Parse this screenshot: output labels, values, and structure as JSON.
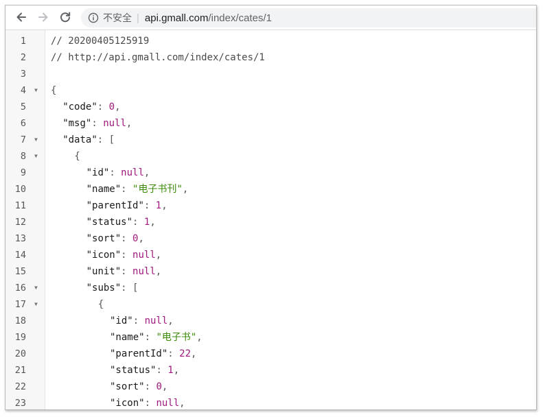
{
  "browser": {
    "security_label": "不安全",
    "url_host": "api.gmall.com",
    "url_path": "/index/cates/1"
  },
  "code_lines": [
    {
      "n": "1",
      "fold": false,
      "indent": 0,
      "parts": [
        {
          "t": "// 20200405125919",
          "c": "c"
        }
      ]
    },
    {
      "n": "2",
      "fold": false,
      "indent": 0,
      "parts": [
        {
          "t": "// http://api.gmall.com/index/cates/1",
          "c": "c"
        }
      ]
    },
    {
      "n": "3",
      "fold": false,
      "indent": 0,
      "parts": []
    },
    {
      "n": "4",
      "fold": true,
      "indent": 0,
      "parts": [
        {
          "t": "{",
          "c": "p"
        }
      ]
    },
    {
      "n": "5",
      "fold": false,
      "indent": 2,
      "parts": [
        {
          "t": "\"code\"",
          "c": "k"
        },
        {
          "t": ": ",
          "c": "p"
        },
        {
          "t": "0",
          "c": "n"
        },
        {
          "t": ",",
          "c": "p"
        }
      ]
    },
    {
      "n": "6",
      "fold": false,
      "indent": 2,
      "parts": [
        {
          "t": "\"msg\"",
          "c": "k"
        },
        {
          "t": ": ",
          "c": "p"
        },
        {
          "t": "null",
          "c": "n"
        },
        {
          "t": ",",
          "c": "p"
        }
      ]
    },
    {
      "n": "7",
      "fold": true,
      "indent": 2,
      "parts": [
        {
          "t": "\"data\"",
          "c": "k"
        },
        {
          "t": ": [",
          "c": "p"
        }
      ]
    },
    {
      "n": "8",
      "fold": true,
      "indent": 4,
      "parts": [
        {
          "t": "{",
          "c": "p"
        }
      ]
    },
    {
      "n": "9",
      "fold": false,
      "indent": 6,
      "parts": [
        {
          "t": "\"id\"",
          "c": "k"
        },
        {
          "t": ": ",
          "c": "p"
        },
        {
          "t": "null",
          "c": "n"
        },
        {
          "t": ",",
          "c": "p"
        }
      ]
    },
    {
      "n": "10",
      "fold": false,
      "indent": 6,
      "parts": [
        {
          "t": "\"name\"",
          "c": "k"
        },
        {
          "t": ": ",
          "c": "p"
        },
        {
          "t": "\"电子书刊\"",
          "c": "s"
        },
        {
          "t": ",",
          "c": "p"
        }
      ]
    },
    {
      "n": "11",
      "fold": false,
      "indent": 6,
      "parts": [
        {
          "t": "\"parentId\"",
          "c": "k"
        },
        {
          "t": ": ",
          "c": "p"
        },
        {
          "t": "1",
          "c": "n"
        },
        {
          "t": ",",
          "c": "p"
        }
      ]
    },
    {
      "n": "12",
      "fold": false,
      "indent": 6,
      "parts": [
        {
          "t": "\"status\"",
          "c": "k"
        },
        {
          "t": ": ",
          "c": "p"
        },
        {
          "t": "1",
          "c": "n"
        },
        {
          "t": ",",
          "c": "p"
        }
      ]
    },
    {
      "n": "13",
      "fold": false,
      "indent": 6,
      "parts": [
        {
          "t": "\"sort\"",
          "c": "k"
        },
        {
          "t": ": ",
          "c": "p"
        },
        {
          "t": "0",
          "c": "n"
        },
        {
          "t": ",",
          "c": "p"
        }
      ]
    },
    {
      "n": "14",
      "fold": false,
      "indent": 6,
      "parts": [
        {
          "t": "\"icon\"",
          "c": "k"
        },
        {
          "t": ": ",
          "c": "p"
        },
        {
          "t": "null",
          "c": "n"
        },
        {
          "t": ",",
          "c": "p"
        }
      ]
    },
    {
      "n": "15",
      "fold": false,
      "indent": 6,
      "parts": [
        {
          "t": "\"unit\"",
          "c": "k"
        },
        {
          "t": ": ",
          "c": "p"
        },
        {
          "t": "null",
          "c": "n"
        },
        {
          "t": ",",
          "c": "p"
        }
      ]
    },
    {
      "n": "16",
      "fold": true,
      "indent": 6,
      "parts": [
        {
          "t": "\"subs\"",
          "c": "k"
        },
        {
          "t": ": [",
          "c": "p"
        }
      ]
    },
    {
      "n": "17",
      "fold": true,
      "indent": 8,
      "parts": [
        {
          "t": "{",
          "c": "p"
        }
      ]
    },
    {
      "n": "18",
      "fold": false,
      "indent": 10,
      "parts": [
        {
          "t": "\"id\"",
          "c": "k"
        },
        {
          "t": ": ",
          "c": "p"
        },
        {
          "t": "null",
          "c": "n"
        },
        {
          "t": ",",
          "c": "p"
        }
      ]
    },
    {
      "n": "19",
      "fold": false,
      "indent": 10,
      "parts": [
        {
          "t": "\"name\"",
          "c": "k"
        },
        {
          "t": ": ",
          "c": "p"
        },
        {
          "t": "\"电子书\"",
          "c": "s"
        },
        {
          "t": ",",
          "c": "p"
        }
      ]
    },
    {
      "n": "20",
      "fold": false,
      "indent": 10,
      "parts": [
        {
          "t": "\"parentId\"",
          "c": "k"
        },
        {
          "t": ": ",
          "c": "p"
        },
        {
          "t": "22",
          "c": "n"
        },
        {
          "t": ",",
          "c": "p"
        }
      ]
    },
    {
      "n": "21",
      "fold": false,
      "indent": 10,
      "parts": [
        {
          "t": "\"status\"",
          "c": "k"
        },
        {
          "t": ": ",
          "c": "p"
        },
        {
          "t": "1",
          "c": "n"
        },
        {
          "t": ",",
          "c": "p"
        }
      ]
    },
    {
      "n": "22",
      "fold": false,
      "indent": 10,
      "parts": [
        {
          "t": "\"sort\"",
          "c": "k"
        },
        {
          "t": ": ",
          "c": "p"
        },
        {
          "t": "0",
          "c": "n"
        },
        {
          "t": ",",
          "c": "p"
        }
      ]
    },
    {
      "n": "23",
      "fold": false,
      "indent": 10,
      "parts": [
        {
          "t": "\"icon\"",
          "c": "k"
        },
        {
          "t": ": ",
          "c": "p"
        },
        {
          "t": "null",
          "c": "n"
        },
        {
          "t": ",",
          "c": "p"
        }
      ]
    }
  ]
}
